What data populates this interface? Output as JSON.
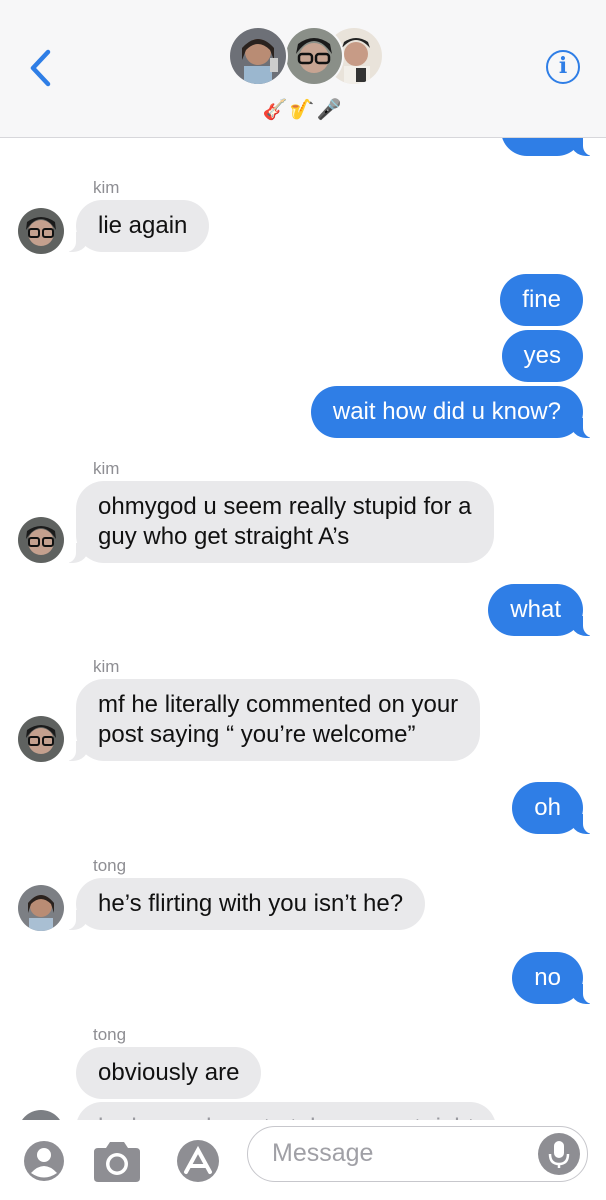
{
  "header": {
    "back_icon": "chevron-left-icon",
    "info_icon": "info-icon",
    "info_label": "i",
    "group_emojis": "🎸🎷🎤",
    "accent": "#2f7ee6"
  },
  "messages": [
    {
      "side": "out",
      "text": "..."
    },
    {
      "sender": "kim"
    },
    {
      "side": "in",
      "text": "lie again"
    },
    {
      "side": "out",
      "text": "fine"
    },
    {
      "side": "out",
      "text": "yes"
    },
    {
      "side": "out",
      "text": "wait how did u know?"
    },
    {
      "sender": "kim"
    },
    {
      "side": "in",
      "text_lines": [
        "ohmygod u seem really stupid for a",
        "guy who get straight A’s"
      ]
    },
    {
      "side": "out",
      "text": "what"
    },
    {
      "sender": "kim"
    },
    {
      "side": "in",
      "text_lines": [
        "mf he literally commented on your",
        "post saying “ you’re welcome”"
      ]
    },
    {
      "side": "out",
      "text": "oh"
    },
    {
      "sender": "tong"
    },
    {
      "side": "in",
      "text": "he’s flirting with you isn’t he?"
    },
    {
      "side": "out",
      "text": "no"
    },
    {
      "sender": "tong"
    },
    {
      "side": "in",
      "text": "obviously are"
    },
    {
      "side": "in",
      "text": "he begged you to take you out right"
    }
  ],
  "input_bar": {
    "placeholder": "Message",
    "contact_icon": "contact-icon",
    "camera_icon": "camera-icon",
    "appstore_icon": "app-store-icon",
    "mic_icon": "microphone-icon"
  }
}
